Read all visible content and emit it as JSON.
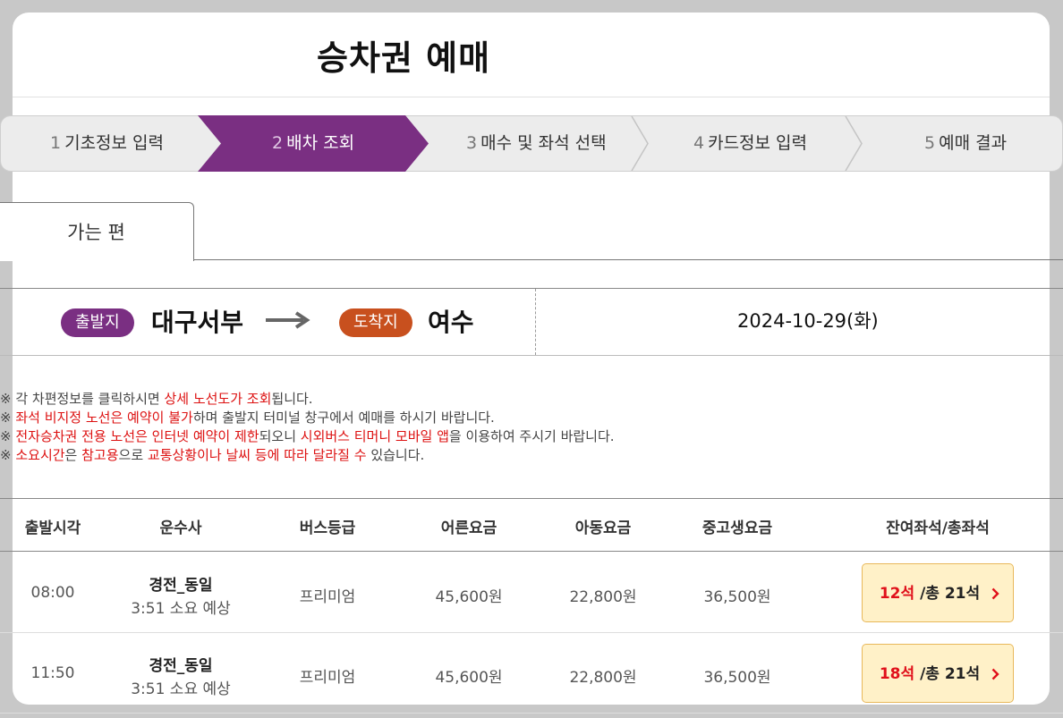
{
  "title": "승차권 예매",
  "steps": [
    {
      "num": "1",
      "label": "기초정보 입력"
    },
    {
      "num": "2",
      "label": "배차 조회"
    },
    {
      "num": "3",
      "label": "매수 및 좌석 선택"
    },
    {
      "num": "4",
      "label": "카드정보 입력"
    },
    {
      "num": "5",
      "label": "예매 결과"
    }
  ],
  "active_step": 2,
  "tab": {
    "label": "가는 편"
  },
  "route": {
    "depart_badge": "출발지",
    "depart": "대구서부",
    "arrive_badge": "도착지",
    "arrive": "여수",
    "date": "2024-10-29(화)"
  },
  "notices": [
    {
      "mark": "※ ",
      "parts": [
        "각 차편정보를 클릭하시면 ",
        "상세 노선도가 조회",
        "됩니다."
      ]
    },
    {
      "mark": "※ ",
      "parts": [
        "",
        "좌석 비지정 노선은 예약이 불가",
        "하며 출발지 터미널 창구에서 예매를 하시기 바랍니다."
      ]
    },
    {
      "mark": "※ ",
      "parts": [
        "",
        "전자승차권 전용 노선은 인터넷 예약이 제한",
        "되오니 ",
        "시외버스 티머니 모바일 앱",
        "을 이용하여 주시기 바랍니다."
      ]
    },
    {
      "mark": "※ ",
      "parts": [
        "",
        "소요시간",
        "은 ",
        "참고용",
        "으로 ",
        "교통상황이나 날씨 등에 따라 달라질 수",
        " 있습니다."
      ]
    }
  ],
  "table": {
    "headers": [
      "출발시각",
      "운수사",
      "버스등급",
      "어른요금",
      "아동요금",
      "중고생요금",
      "잔여좌석/총좌석"
    ],
    "rows": [
      {
        "time": "08:00",
        "company": "경전_동일",
        "duration": "3:51 소요 예상",
        "grade": "프리미엄",
        "adult": "45,600원",
        "child": "22,800원",
        "youth": "36,500원",
        "remain": "12석",
        "total": " /총 21석"
      },
      {
        "time": "11:50",
        "company": "경전_동일",
        "duration": "3:51 소요 예상",
        "grade": "프리미엄",
        "adult": "45,600원",
        "child": "22,800원",
        "youth": "36,500원",
        "remain": "18석",
        "total": " /총 21석"
      }
    ]
  },
  "colors": {
    "accent": "#7a2f82",
    "arrive": "#c8501e",
    "seat_remain": "#e0101a",
    "seat_bg": "#fff1c8"
  },
  "icons": {
    "route_arrow": "long-arrow-right-icon",
    "seat_chevron": "chevron-right-icon"
  }
}
